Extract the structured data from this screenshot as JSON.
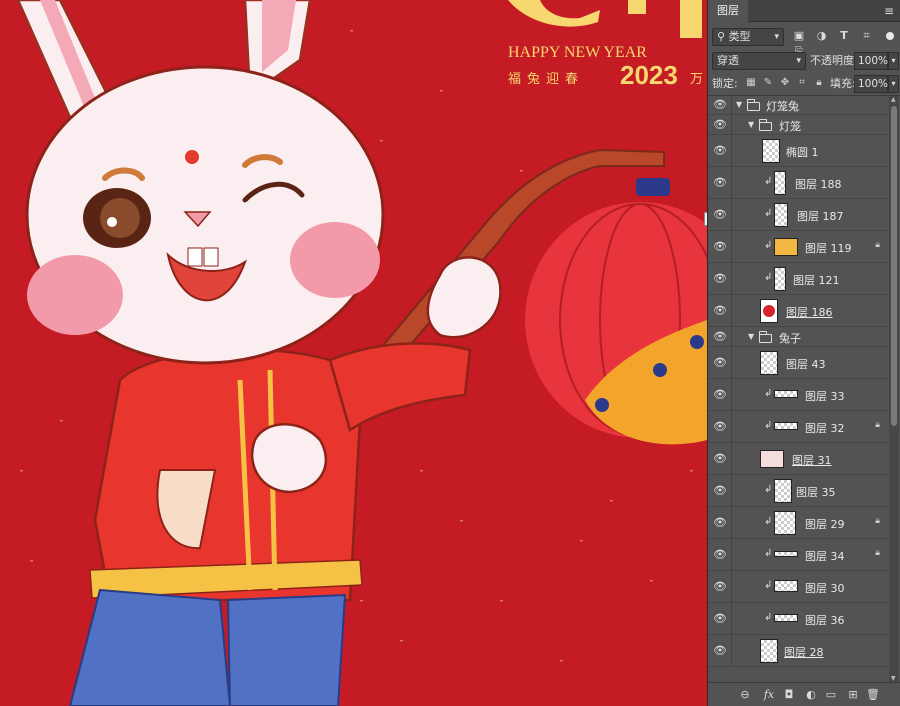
{
  "canvas": {
    "banner_en": "HAPPY NEW YEAR",
    "banner_cn": "福兔迎春",
    "banner_year": "2023",
    "banner_tail": "万",
    "tooltip_fragment": "t"
  },
  "panel": {
    "tab_label": "图层",
    "menu_icon": "≡",
    "filter": {
      "label": "类型",
      "icon": "search-icon"
    },
    "filter_icons": [
      "image-filter-icon",
      "adjustment-filter-icon",
      "type-filter-icon",
      "shape-filter-icon",
      "smart-object-filter-icon"
    ],
    "blend_mode": "穿透",
    "opacity_label": "不透明度:",
    "opacity_value": "100%",
    "lock_label": "锁定:",
    "fill_label": "填充:",
    "fill_value": "100%",
    "layers": [
      {
        "name": "灯笼兔",
        "kind": "group",
        "expanded": true
      },
      {
        "name": "灯笼",
        "kind": "group",
        "expanded": true
      },
      {
        "name": "椭圆 1",
        "kind": "layer"
      },
      {
        "name": "图层 188",
        "kind": "layer",
        "clipped": true
      },
      {
        "name": "图层 187",
        "kind": "layer",
        "clipped": true
      },
      {
        "name": "图层 119",
        "kind": "layer",
        "clipped": true,
        "locked": true
      },
      {
        "name": "图层 121",
        "kind": "layer",
        "clipped": true
      },
      {
        "name": "图层 186",
        "kind": "layer",
        "underlined": true
      },
      {
        "name": "兔子",
        "kind": "group",
        "expanded": true
      },
      {
        "name": "图层 43",
        "kind": "layer"
      },
      {
        "name": "图层 33",
        "kind": "layer",
        "clipped": true
      },
      {
        "name": "图层 32",
        "kind": "layer",
        "clipped": true,
        "locked": true
      },
      {
        "name": "图层 31",
        "kind": "layer",
        "underlined": true
      },
      {
        "name": "图层 35",
        "kind": "layer",
        "clipped": true
      },
      {
        "name": "图层 29",
        "kind": "layer",
        "clipped": true,
        "locked": true
      },
      {
        "name": "图层 34",
        "kind": "layer",
        "clipped": true,
        "locked": true
      },
      {
        "name": "图层 30",
        "kind": "layer",
        "clipped": true
      },
      {
        "name": "图层 36",
        "kind": "layer",
        "clipped": true
      },
      {
        "name": "图层 28",
        "kind": "layer",
        "underlined": true
      }
    ],
    "bottom_icons": [
      "link-layers-icon",
      "fx-icon",
      "layer-mask-icon",
      "adjustment-layer-icon",
      "new-group-icon",
      "new-layer-icon",
      "delete-icon"
    ],
    "bottom_glyphs": [
      "⊖",
      "fx",
      "◘",
      "◐",
      "▭",
      "⊞",
      "🗑"
    ]
  }
}
